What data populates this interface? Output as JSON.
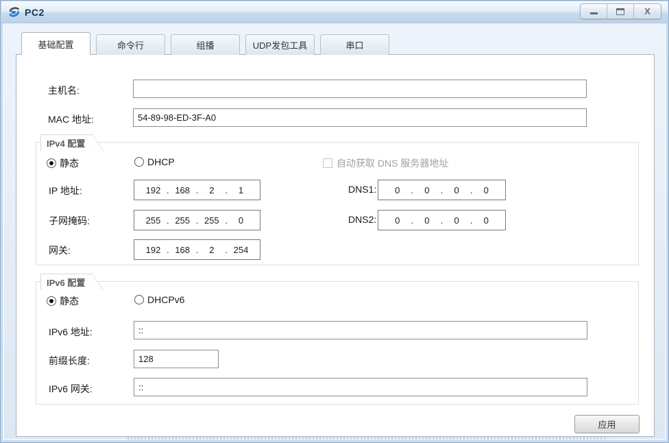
{
  "window": {
    "title": "PC2",
    "close_glyph": "X"
  },
  "tabs": [
    {
      "label": "基础配置",
      "active": true
    },
    {
      "label": "命令行",
      "active": false
    },
    {
      "label": "组播",
      "active": false
    },
    {
      "label": "UDP发包工具",
      "active": false
    },
    {
      "label": "串口",
      "active": false
    }
  ],
  "form": {
    "hostname": {
      "label": "主机名:",
      "value": ""
    },
    "mac": {
      "label": "MAC 地址:",
      "value": "54-89-98-ED-3F-A0"
    },
    "ipv4": {
      "group_label": "IPv4 配置",
      "static_label": "静态",
      "dhcp_label": "DHCP",
      "dns_auto_label": "自动获取 DNS 服务器地址",
      "ip": {
        "label": "IP 地址:",
        "octets": [
          "192",
          "168",
          "2",
          "1"
        ]
      },
      "mask": {
        "label": "子网掩码:",
        "octets": [
          "255",
          "255",
          "255",
          "0"
        ]
      },
      "gateway": {
        "label": "网关:",
        "octets": [
          "192",
          "168",
          "2",
          "254"
        ]
      },
      "dns1": {
        "label": "DNS1:",
        "octets": [
          "0",
          "0",
          "0",
          "0"
        ]
      },
      "dns2": {
        "label": "DNS2:",
        "octets": [
          "0",
          "0",
          "0",
          "0"
        ]
      }
    },
    "ipv6": {
      "group_label": "IPv6 配置",
      "static_label": "静态",
      "dhcp_label": "DHCPv6",
      "address": {
        "label": "IPv6 地址:",
        "value": "::"
      },
      "prefix": {
        "label": "前缀长度:",
        "value": "128"
      },
      "gateway": {
        "label": "IPv6 网关:",
        "value": "::"
      }
    },
    "apply_label": "应用"
  },
  "colors": {
    "titlebar_top": "#f7fbfe",
    "titlebar_bottom": "#bed3e9",
    "title_text": "#17365c",
    "panel_border": "#a8b2ba",
    "disabled_text": "#9da1a6"
  }
}
